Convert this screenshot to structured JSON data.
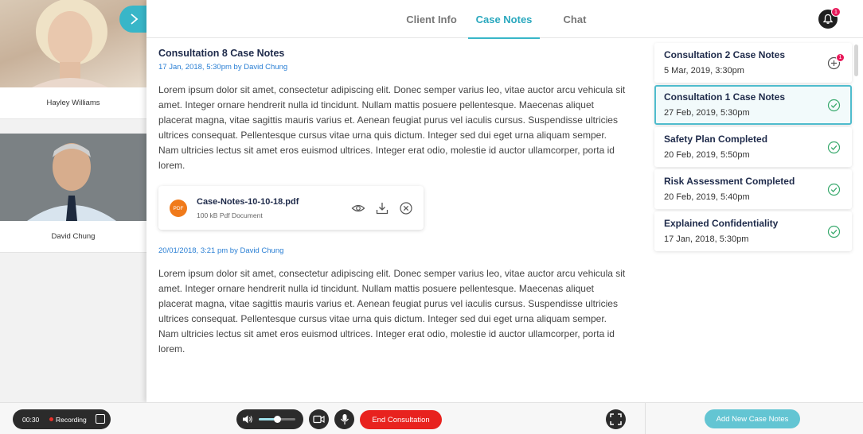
{
  "participants": [
    {
      "name": "Hayley Williams"
    },
    {
      "name": "David Chung"
    }
  ],
  "tabs": [
    {
      "label": "Client Info",
      "active": false
    },
    {
      "label": "Case Notes",
      "active": true
    },
    {
      "label": "Chat",
      "active": false
    }
  ],
  "notifications": {
    "count": "1"
  },
  "note": {
    "title": "Consultation 8 Case Notes",
    "meta1": "17 Jan,  2018, 5:30pm by David Chung",
    "body1": "Lorem ipsum dolor sit amet, consectetur adipiscing elit. Donec semper varius leo, vitae auctor arcu vehicula sit amet. Integer ornare hendrerit nulla id tincidunt. Nullam mattis posuere pellentesque. Maecenas aliquet placerat magna, vitae sagittis mauris varius et. Aenean feugiat purus vel iaculis cursus. Suspendisse ultricies ultrices consequat. Pellentesque cursus vitae urna quis dictum. Integer sed dui eget urna aliquam semper. Nam ultricies lectus sit amet eros euismod ultrices. Integer erat odio, molestie id auctor ullamcorper, porta id lorem.",
    "attachment": {
      "icon_label": "PDF",
      "name": "Case-Notes-10-10-18.pdf",
      "meta": "100 kB  Pdf Document"
    },
    "meta2": "20/01/2018, 3:21 pm by David Chung",
    "body2": "Lorem ipsum dolor sit amet, consectetur adipiscing elit. Donec semper varius leo, vitae auctor arcu vehicula sit amet. Integer ornare hendrerit nulla id tincidunt. Nullam mattis posuere pellentesque. Maecenas aliquet placerat magna, vitae sagittis mauris varius et. Aenean feugiat purus vel iaculis cursus. Suspendisse ultricies ultrices consequat. Pellentesque cursus vitae urna quis dictum. Integer sed dui eget urna aliquam semper. Nam ultricies lectus sit amet eros euismod ultrices. Integer erat odio, molestie id auctor ullamcorper, porta id lorem."
  },
  "case_list": [
    {
      "title": "Consultation 2 Case Notes",
      "date": "5 Mar, 2019, 3:30pm",
      "icon": "add-icon",
      "badge": "1",
      "selected": false
    },
    {
      "title": "Consultation 1 Case Notes",
      "date": "27 Feb, 2019, 5:30pm",
      "icon": "check-circle-icon",
      "selected": true
    },
    {
      "title": "Safety Plan Completed",
      "date": "20 Feb, 2019, 5:50pm",
      "icon": "check-circle-icon",
      "selected": false
    },
    {
      "title": "Risk Assessment Completed",
      "date": "20 Feb, 2019, 5:40pm",
      "icon": "check-circle-icon",
      "selected": false
    },
    {
      "title": "Explained Confidentiality",
      "date": "17 Jan, 2018, 5:30pm",
      "icon": "check-circle-icon",
      "selected": false
    }
  ],
  "bottom_bar": {
    "recording_time": "00:30",
    "recording_label": "Recording",
    "volume_level": 0.5,
    "end_label": "End Consultation",
    "add_label": "Add New Case Notes"
  },
  "colors": {
    "accent": "#38b6c8",
    "end": "#e8221e",
    "badge": "#e8195a",
    "link": "#2a7fd4"
  }
}
